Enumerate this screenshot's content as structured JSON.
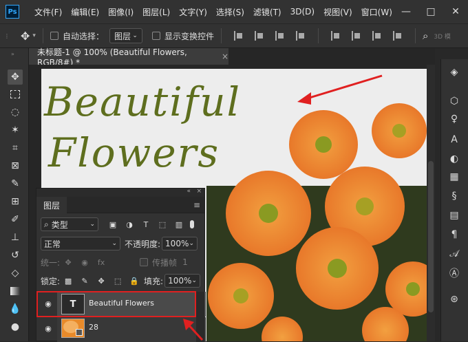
{
  "app": {
    "logo": "Ps"
  },
  "menu": [
    "文件(F)",
    "编辑(E)",
    "图像(I)",
    "图层(L)",
    "文字(Y)",
    "选择(S)",
    "滤镜(T)",
    "3D(D)",
    "视图(V)",
    "窗口(W)"
  ],
  "window_controls": {
    "minimize": "—",
    "maximize": "□",
    "close": "✕"
  },
  "options": {
    "auto_select_label": "自动选择：",
    "auto_select_target": "图层",
    "show_transform_label": "显示变换控件",
    "mode_3d": "3D 模"
  },
  "document_tab": {
    "title": "未标题-1 @ 100% (Beautiful  Flowers, RGB/8#) *",
    "close": "×"
  },
  "canvas": {
    "title_line1": "Beautiful",
    "title_line2": "Flowers",
    "text_color": "#5e6e1e",
    "arrow_color": "#e02020"
  },
  "layers_panel": {
    "collapse": "«",
    "close": "×",
    "tab_label": "图层",
    "filter_kind": "类型",
    "blend_mode": "正常",
    "opacity_label": "不透明度:",
    "opacity_value": "100%",
    "unify_label": "统一:",
    "propagate_label": "传播帧",
    "propagate_number": "1",
    "lock_label": "锁定:",
    "fill_label": "填充:",
    "fill_value": "100%",
    "layers": [
      {
        "name": "Beautiful  Flowers",
        "type": "text",
        "thumb": "T"
      },
      {
        "name": "28",
        "type": "image"
      }
    ]
  }
}
